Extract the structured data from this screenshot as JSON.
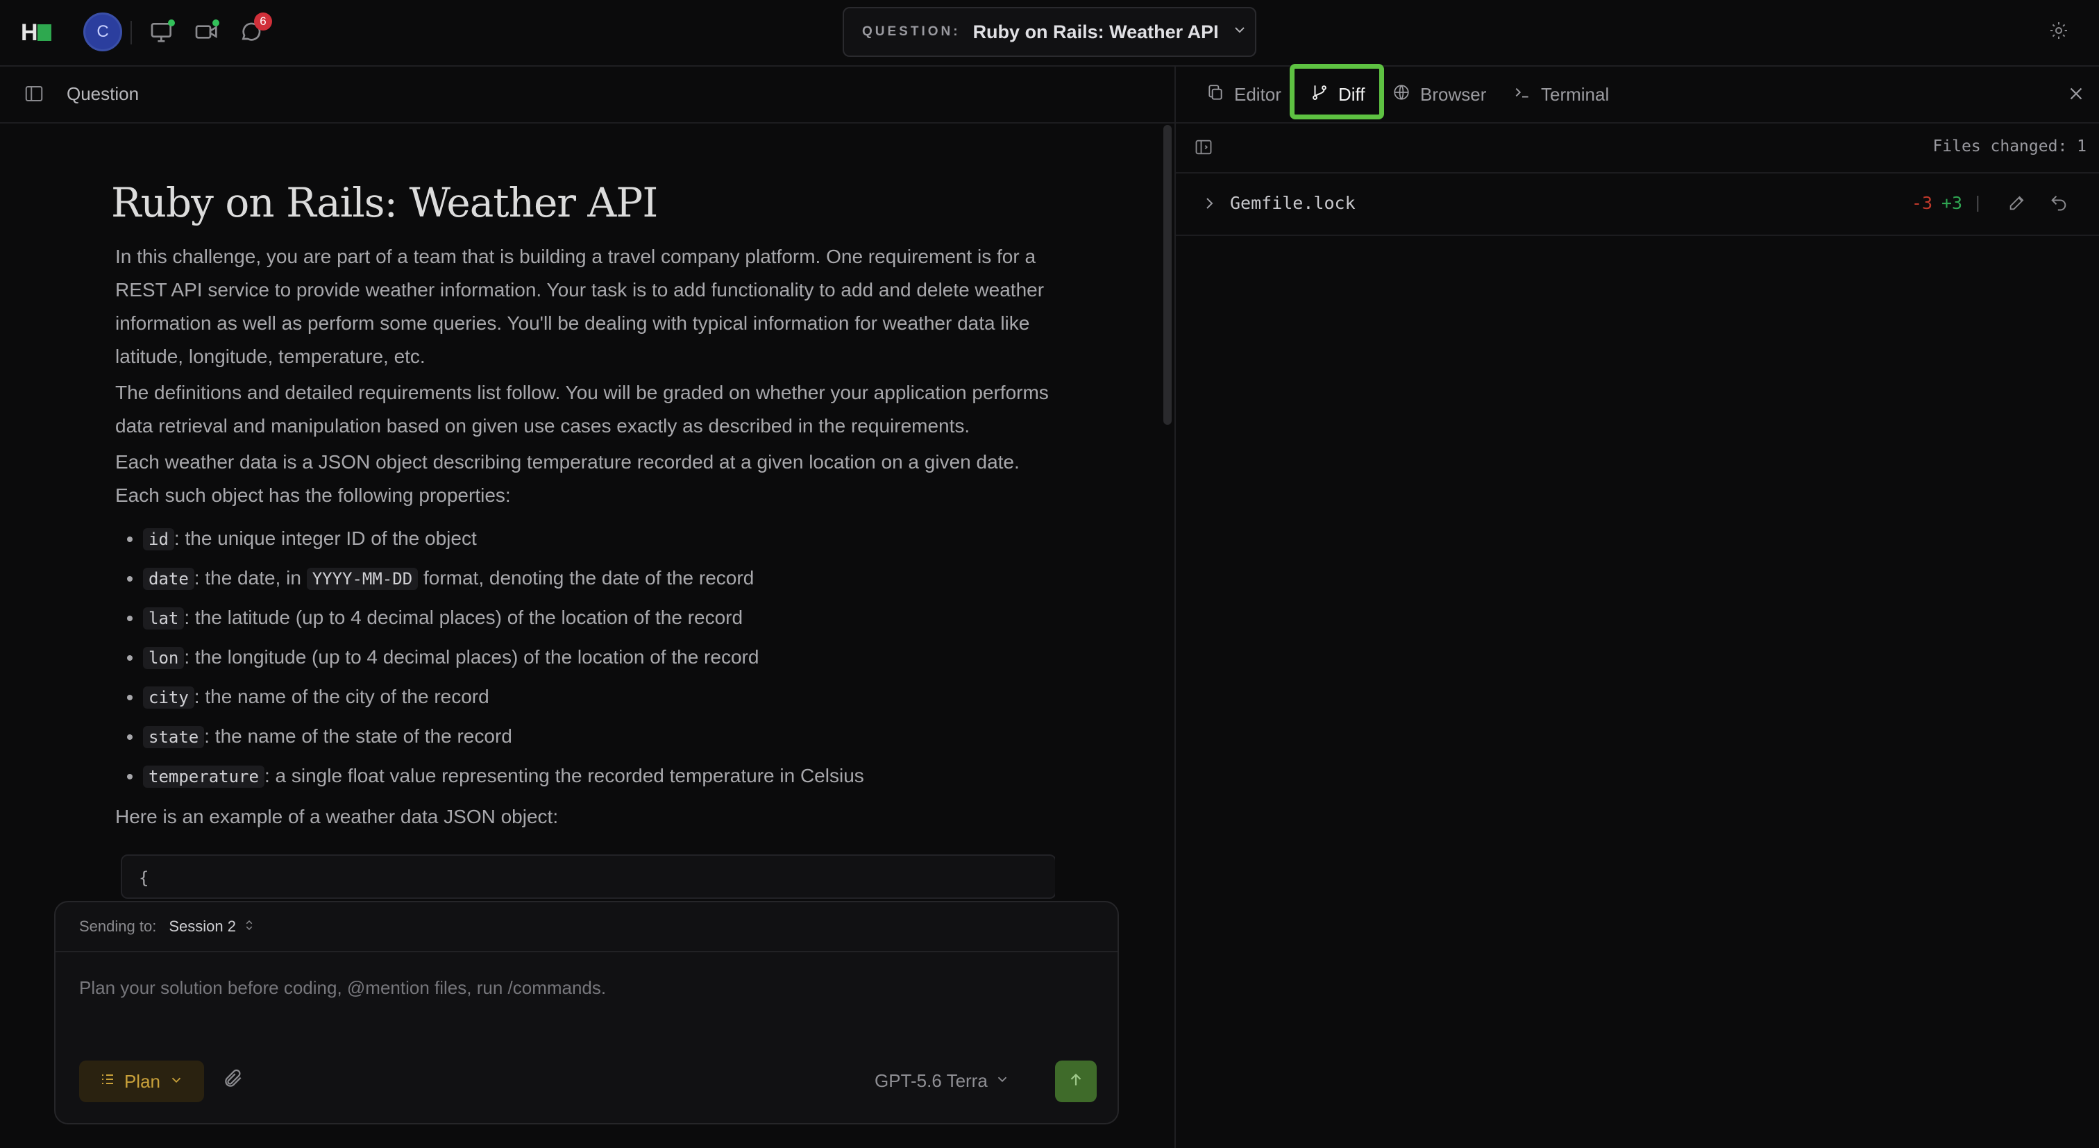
{
  "topbar": {
    "logo_letter": "H",
    "avatar_initial": "C",
    "notifications_count": "6",
    "question_label": "QUESTION:",
    "question_title": "Ruby on Rails: Weather API"
  },
  "left_panel": {
    "header_title": "Question",
    "doc_title": "Ruby on Rails: Weather API",
    "paragraphs": [
      "In this challenge, you are part of a team that is building a travel company platform. One requirement is for a REST API service to provide weather information. Your task is to add functionality to add and delete weather information as well as perform some queries. You'll be dealing with typical information for weather data like latitude, longitude, temperature, etc.",
      "The definitions and detailed requirements list follow. You will be graded on whether your application performs data retrieval and manipulation based on given use cases exactly as described in the requirements.",
      "Each weather data is a JSON object describing temperature recorded at a given location on a given date. Each such object has the following properties:"
    ],
    "properties": [
      {
        "code": "id",
        "text": ": the unique integer ID of the object"
      },
      {
        "code": "date",
        "text_before": ": the date, in ",
        "code2": "YYYY-MM-DD",
        "text": " format, denoting the date of the record"
      },
      {
        "code": "lat",
        "text": ": the latitude (up to 4 decimal places) of the location of the record"
      },
      {
        "code": "lon",
        "text": ": the longitude (up to 4 decimal places) of the location of the record"
      },
      {
        "code": "city",
        "text": ": the name of the city of the record"
      },
      {
        "code": "state",
        "text": ": the name of the state of the record"
      },
      {
        "code": "temperature",
        "text": ": a single float value representing the recorded temperature in Celsius"
      }
    ],
    "example_intro": "Here is an example of a weather data JSON object:",
    "code_first_line": "{"
  },
  "composer": {
    "sending_label": "Sending to:",
    "session": "Session 2",
    "placeholder": "Plan your solution before coding, @mention files, run /commands.",
    "mode": "Plan",
    "model": "GPT-5.6 Terra"
  },
  "right_panel": {
    "tabs": [
      {
        "label": "Editor"
      },
      {
        "label": "Diff"
      },
      {
        "label": "Browser"
      },
      {
        "label": "Terminal"
      }
    ],
    "files_changed": "Files changed: 1",
    "file": {
      "name": "Gemfile.lock",
      "deletions": "-3",
      "additions": "+3",
      "separator": "|"
    }
  },
  "colors": {
    "accent_green": "#5ec242",
    "deletions": "#c0392b",
    "additions": "#2fa552",
    "plan_text": "#c9a13a"
  }
}
